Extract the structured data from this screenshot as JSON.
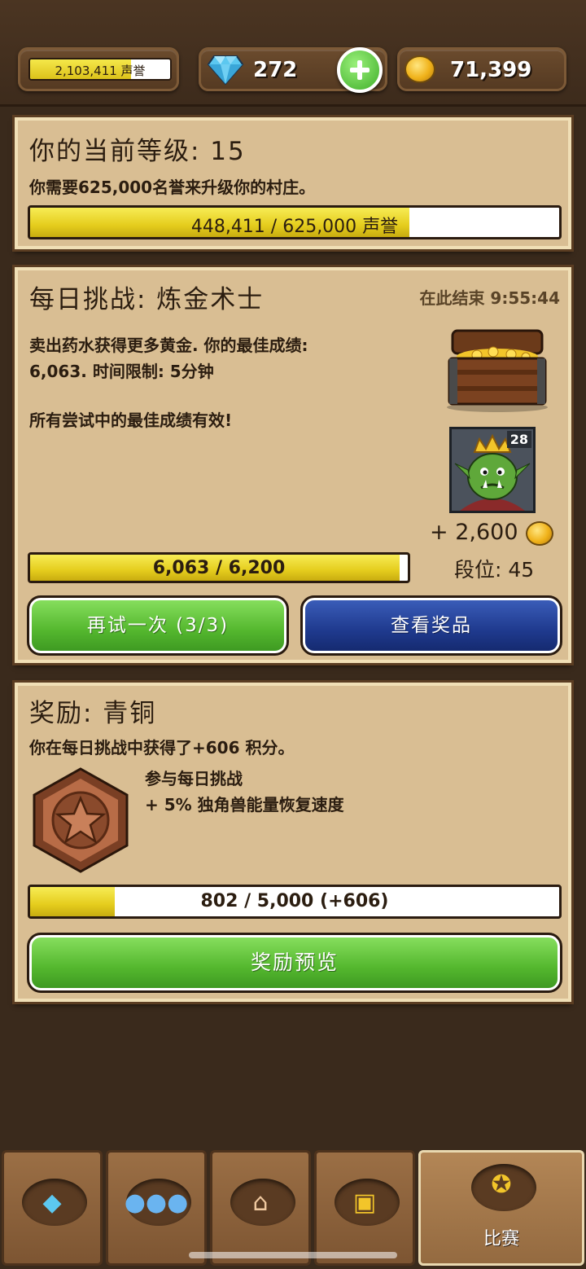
{
  "topbar": {
    "reputation": "2,103,411 声誉",
    "gems": "272",
    "gold": "71,399"
  },
  "level_panel": {
    "title": "你的当前等级: 15",
    "desc": "你需要625,000名誉来升级你的村庄。",
    "progress_text": "448,411 / 625,000 声誉",
    "progress": 0.7175
  },
  "challenge_panel": {
    "title": "每日挑战: 炼金术士",
    "timer": "在此结束 9:55:44",
    "desc_line1": "卖出药水获得更多黄金. 你的最佳成绩:",
    "desc_line2": "6,063. 时间限制: 5分钟",
    "note": "所有尝试中的最佳成绩有效!",
    "avatar_level": "28",
    "reward_gold": "+ 2,600",
    "rank": "段位: 45",
    "progress_text": "6,063 / 6,200",
    "progress": 0.978,
    "retry_label": "再试一次 (3/3)",
    "prizes_label": "查看奖品"
  },
  "reward_panel": {
    "title": "奖励: 青铜",
    "desc": "你在每日挑战中获得了+606 积分。",
    "perk1": "参与每日挑战",
    "perk2": "+ 5% 独角兽能量恢复速度",
    "progress_text": "802 / 5,000 (+606)",
    "progress": 0.1604,
    "preview_label": "奖励预览"
  },
  "nav": {
    "active_label": "比赛",
    "icons": [
      "gem-icon",
      "people-icon",
      "house-icon",
      "chest-icon",
      "medal-icon"
    ]
  }
}
